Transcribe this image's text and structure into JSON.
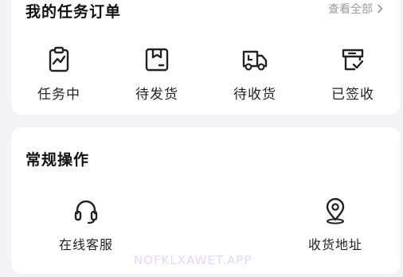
{
  "orders": {
    "title": "我的任务订单",
    "view_all": "查看全部",
    "items": [
      {
        "label": "任务中",
        "icon": "task-clipboard-icon"
      },
      {
        "label": "待发货",
        "icon": "package-box-icon"
      },
      {
        "label": "待收货",
        "icon": "delivery-truck-icon"
      },
      {
        "label": "已签收",
        "icon": "signed-receipt-icon"
      }
    ]
  },
  "operations": {
    "title": "常规操作",
    "items": [
      {
        "label": "在线客服",
        "icon": "headset-icon"
      },
      {
        "label": "收货地址",
        "icon": "location-pin-icon"
      }
    ]
  },
  "watermark": "NOFKLXAWET.APP"
}
